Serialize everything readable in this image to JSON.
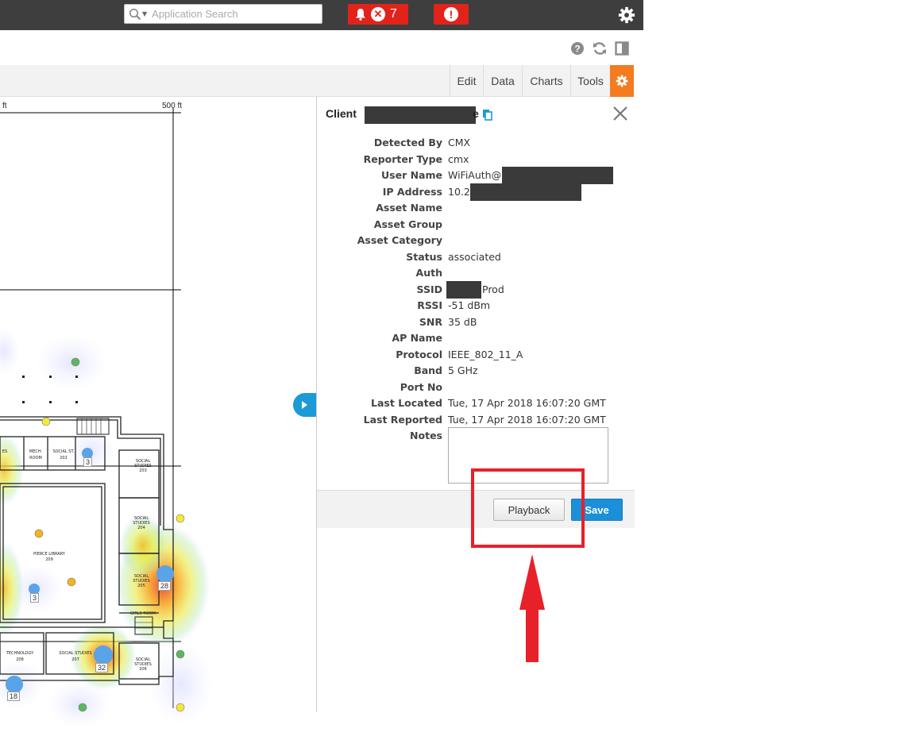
{
  "topbar": {
    "search_placeholder": "Application Search",
    "alarm_count": "7",
    "alarm_x": "✕",
    "warning_glyph": "!"
  },
  "toolbar": {
    "buttons": [
      "Edit",
      "Data",
      "Charts",
      "Tools"
    ]
  },
  "map": {
    "scale_left": "ft",
    "scale_right": "500 ft",
    "cluster_labels": [
      "3",
      "28",
      "3",
      "32",
      "18"
    ]
  },
  "panel": {
    "title_prefix": "Client",
    "title_suffix": "e",
    "fields": [
      {
        "label": "Detected By",
        "value": "CMX"
      },
      {
        "label": "Reporter Type",
        "value": "cmx"
      },
      {
        "label": "User Name",
        "value": "WiFiAuth@"
      },
      {
        "label": "IP Address",
        "value": "10.2"
      },
      {
        "label": "Asset Name",
        "value": ""
      },
      {
        "label": "Asset Group",
        "value": ""
      },
      {
        "label": "Asset Category",
        "value": ""
      },
      {
        "label": "Status",
        "value": "associated"
      },
      {
        "label": "Auth",
        "value": ""
      },
      {
        "label": "SSID",
        "value": "Prod"
      },
      {
        "label": "RSSI",
        "value": "-51 dBm"
      },
      {
        "label": "SNR",
        "value": "35 dB"
      },
      {
        "label": "AP Name",
        "value": ""
      },
      {
        "label": "Protocol",
        "value": "IEEE_802_11_A"
      },
      {
        "label": "Band",
        "value": "5 GHz"
      },
      {
        "label": "Port No",
        "value": ""
      },
      {
        "label": "Last Located",
        "value": "Tue, 17 Apr 2018 16:07:20 GMT"
      },
      {
        "label": "Last Reported",
        "value": "Tue, 17 Apr 2018 16:07:20 GMT"
      }
    ],
    "notes_label": "Notes",
    "playback_label": "Playback",
    "save_label": "Save"
  },
  "colors": {
    "accent_orange": "#f47b20",
    "alarm_red": "#e2231a",
    "save_blue": "#1b8fd8",
    "annotation_red": "#e8202a"
  }
}
